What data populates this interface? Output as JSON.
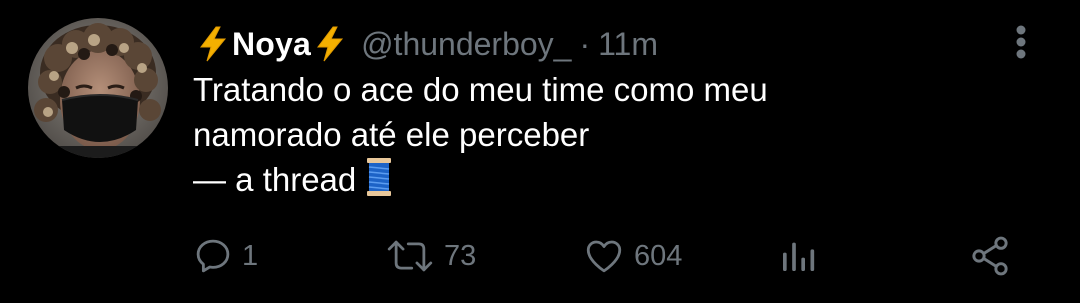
{
  "tweet": {
    "display_name": "Noya",
    "display_name_decoration": "⚡ (lightning bolt emoji on both sides)",
    "handle": "@thunderboy_",
    "separator": "·",
    "timestamp": "11m",
    "text_lines": [
      "Tratando o ace do meu time como meu",
      "namorado até ele perceber",
      "— a thread"
    ],
    "text_emoji": "spool-of-thread",
    "reply_count": "1",
    "retweet_count": "73",
    "like_count": "604"
  },
  "colors": {
    "background": "#000000",
    "primary_text": "#ffffff",
    "secondary_text": "#6e767d",
    "icon": "#6e767d",
    "bolt_yellow": "#f4b000"
  },
  "icons": {
    "more": "vertical-ellipsis-icon",
    "reply": "speech-bubble-icon",
    "retweet": "retweet-arrows-icon",
    "like": "heart-icon",
    "analytics": "bar-chart-icon",
    "share": "share-nodes-icon"
  }
}
